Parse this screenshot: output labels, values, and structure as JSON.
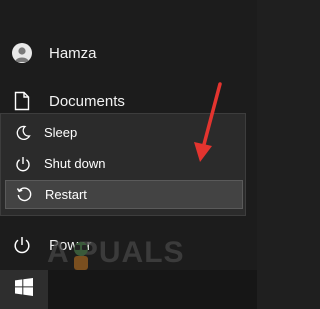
{
  "user": {
    "name": "Hamza",
    "icon": "user-avatar"
  },
  "documents": {
    "label": "Documents",
    "icon": "document-icon"
  },
  "power_menu": {
    "items": [
      {
        "label": "Sleep",
        "icon": "moon-icon"
      },
      {
        "label": "Shut down",
        "icon": "power-icon"
      },
      {
        "label": "Restart",
        "icon": "restart-icon",
        "selected": true
      }
    ]
  },
  "power": {
    "label": "Power",
    "icon": "power-icon"
  },
  "taskbar": {
    "start_icon": "windows-logo-icon"
  },
  "watermark": {
    "text": "A  PUALS"
  },
  "colors": {
    "background": "#1c1c1c",
    "flyout": "#2b2b2b",
    "selected": "#434343",
    "arrow": "#e3342f"
  }
}
